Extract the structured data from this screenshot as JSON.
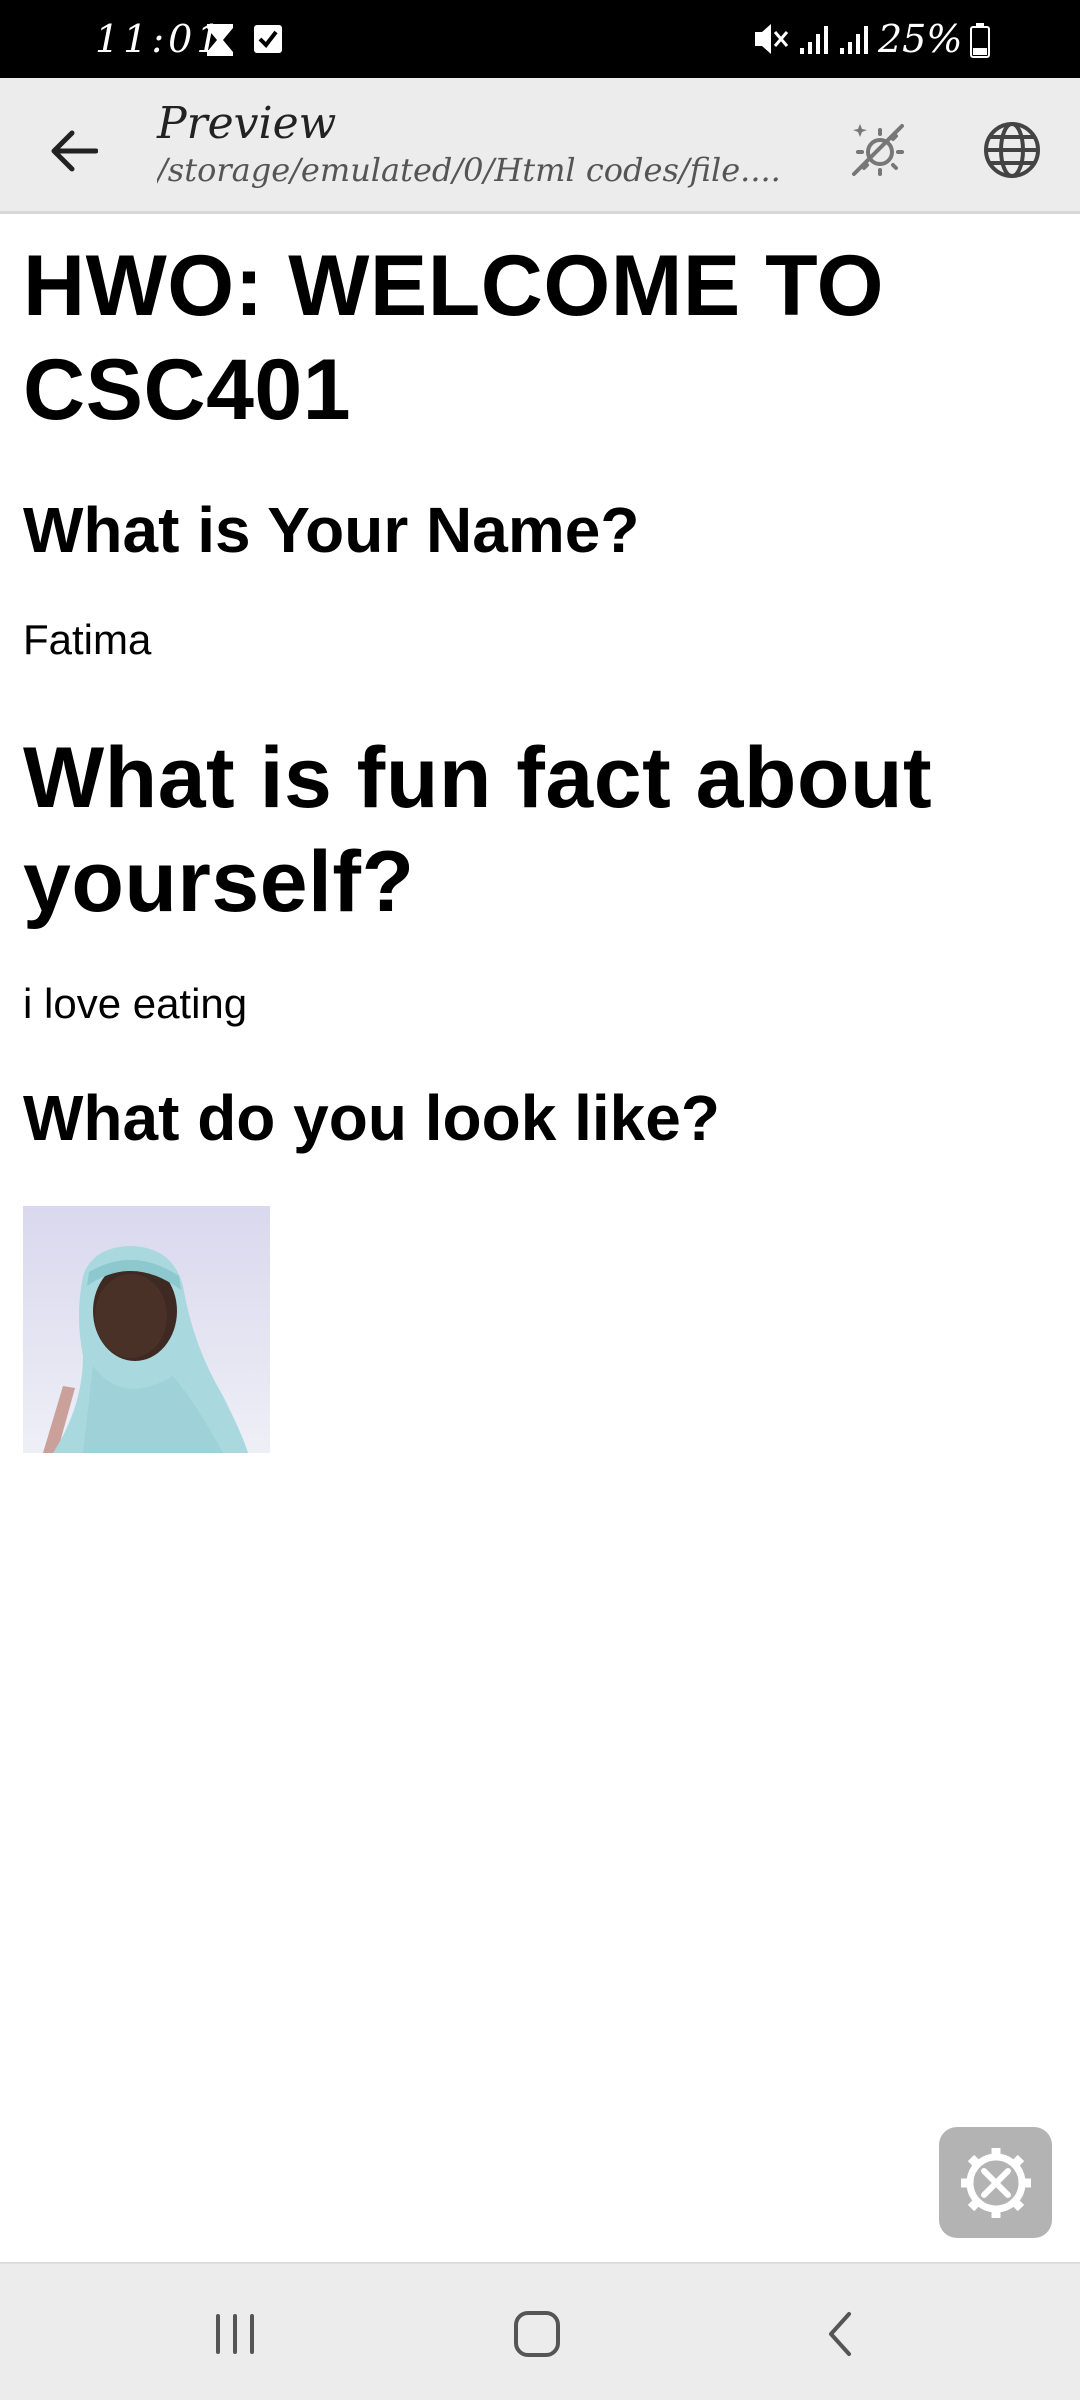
{
  "status_bar": {
    "time": "11:01",
    "battery": "25%",
    "icons": [
      "hourglass-icon",
      "checkbox-icon",
      "mute-icon",
      "signal-icon",
      "signal-icon",
      "battery-icon"
    ]
  },
  "app_bar": {
    "title": "Preview",
    "subtitle": "/storage/emulated/0/Html codes/file....",
    "icons": [
      "back-arrow-icon",
      "theme-toggle-icon",
      "globe-icon"
    ]
  },
  "page": {
    "heading": "HWO: WELCOME TO CSC401",
    "q1": "What is Your Name?",
    "a1": "Fatima",
    "q2": "What is fun fact about yourself?",
    "a2": "i love eating",
    "q3": "What do you look like?"
  },
  "fab": {
    "icon": "settings-tools-icon"
  },
  "nav_bar": {
    "icons": [
      "recent-apps-icon",
      "home-icon",
      "back-icon"
    ]
  },
  "colors": {
    "status_bar": "#000000",
    "app_bar": "#ececec",
    "nav_bar": "#ececec",
    "fab": "#b3b3b3",
    "text": "#000000"
  }
}
